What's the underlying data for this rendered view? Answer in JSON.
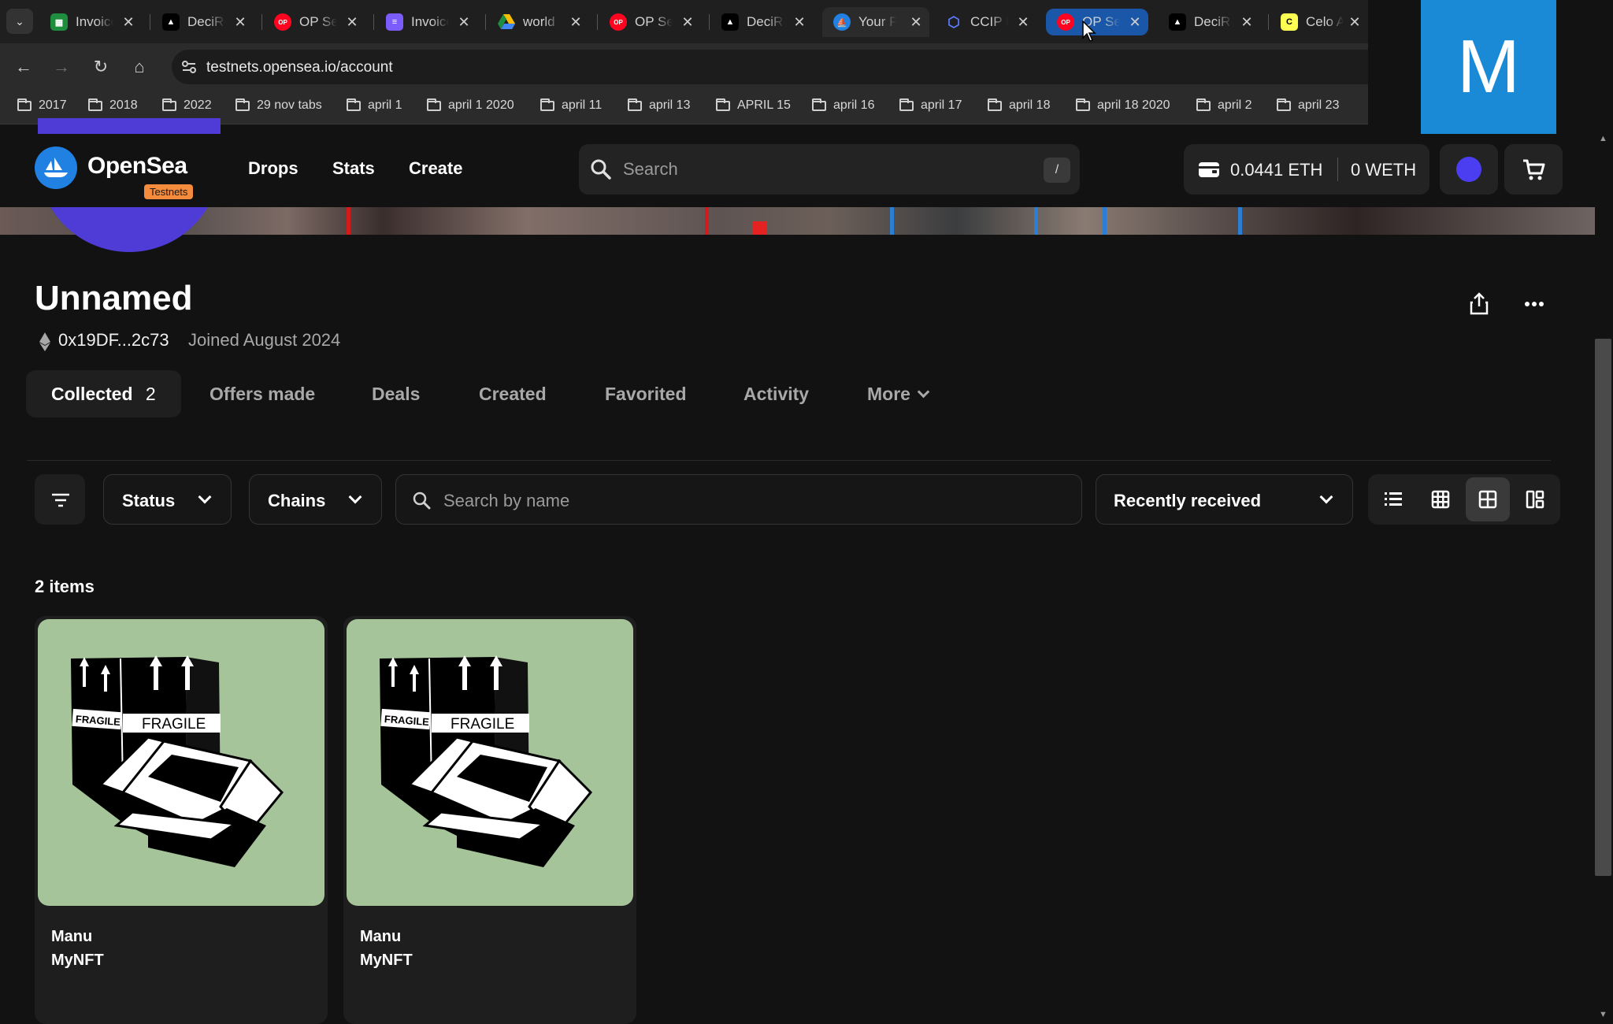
{
  "browser": {
    "tabs": [
      {
        "title": "Invoice",
        "favicon": "sheets-icon",
        "color": "#1e8e3e"
      },
      {
        "title": "DeciRe",
        "favicon": "triangle-logo-icon",
        "color": "#ffffff"
      },
      {
        "title": "OP Sepolia",
        "favicon": "op-icon",
        "color": "#ff0420"
      },
      {
        "title": "Invoice",
        "favicon": "doc-icon",
        "color": "#7b5cff"
      },
      {
        "title": "world",
        "favicon": "drive-icon",
        "color": "#fbbc04"
      },
      {
        "title": "OP Sepolia",
        "favicon": "op-icon",
        "color": "#ff0420"
      },
      {
        "title": "DeciRe",
        "favicon": "triangle-logo-icon",
        "color": "#ffffff"
      },
      {
        "title": "Your Profile",
        "favicon": "opensea-icon",
        "color": "#2081e2"
      },
      {
        "title": "CCIP Explorer",
        "favicon": "chainlink-icon",
        "color": "#375bd2"
      },
      {
        "title": "OP Sepolia",
        "favicon": "op-icon",
        "color": "#ff0420"
      },
      {
        "title": "DeciRe",
        "favicon": "triangle-logo-icon",
        "color": "#ffffff"
      },
      {
        "title": "Celo Alfajores",
        "favicon": "celo-icon",
        "color": "#fcff52"
      }
    ],
    "url": "testnets.opensea.io/account",
    "bookmarks": [
      "2017",
      "2018",
      "2022",
      "29 nov tabs",
      "april 1",
      "april 1 2020",
      "april 11",
      "april 13",
      "APRIL 15",
      "april 16",
      "april 17",
      "april 18",
      "april 18 2020",
      "april 2",
      "april 23"
    ],
    "overlay_letter": "M"
  },
  "header": {
    "logo": "OpenSea",
    "badge": "Testnets",
    "nav": [
      "Drops",
      "Stats",
      "Create"
    ],
    "search_placeholder": "Search",
    "search_shortcut": "/",
    "eth_balance": "0.0441 ETH",
    "weth_balance": "0 WETH"
  },
  "profile": {
    "name": "Unnamed",
    "address": "0x19DF...2c73",
    "joined": "Joined August 2024"
  },
  "tabs": {
    "collected_label": "Collected",
    "collected_count": "2",
    "others": [
      "Offers made",
      "Deals",
      "Created",
      "Favorited",
      "Activity"
    ],
    "more": "More"
  },
  "filters": {
    "status": "Status",
    "chains": "Chains",
    "search_placeholder": "Search by name",
    "sort": "Recently received"
  },
  "items_count": "2 items",
  "items": [
    {
      "title": "Manu",
      "collection": "MyNFT",
      "label": "FRAGILE"
    },
    {
      "title": "Manu",
      "collection": "MyNFT",
      "label": "FRAGILE"
    }
  ],
  "colors": {
    "accent": "#2081e2",
    "badge": "#f58b3c",
    "card_bg": "#a6c49a",
    "avatar": "#4f3bd6"
  }
}
